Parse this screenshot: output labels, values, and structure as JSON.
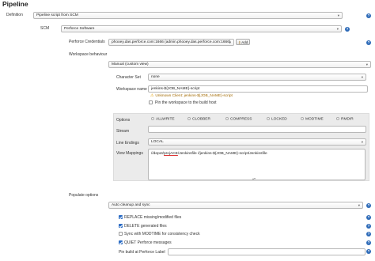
{
  "page": {
    "title": "Pipeline"
  },
  "definition": {
    "label": "Definition",
    "value": "Pipeline script from SCM"
  },
  "scm": {
    "label": "SCM",
    "value": "Perforce Software"
  },
  "credentials": {
    "label": "Perforce Credentials",
    "value": "phooey.das.perforce.com:1666 (admin.phooey.das.perforce.com:1666)",
    "add_label": "Add"
  },
  "workspace": {
    "section_label": "Workspace behaviour",
    "type_value": "Manual (custom view)",
    "charset_label": "Character Set",
    "charset_value": "none",
    "name_label": "Workspace name",
    "name_value": "jenkins-${JOB_NAME}-script",
    "warning": "Unknown Client: jenkins-${JOB_NAME}-script",
    "pin_label": "Pin the workspace to the build host"
  },
  "options": {
    "label": "Options",
    "items": [
      "ALLWRITE",
      "CLOBBER",
      "COMPRESS",
      "LOCKED",
      "MODTIME",
      "RMDIR"
    ],
    "stream_label": "Stream",
    "line_endings_label": "Line Endings",
    "line_endings_value": "LOCAL",
    "view_mappings_label": "View Mappings",
    "view_mappings_pre": "//depot/",
    "view_mappings_underlined": "projACE",
    "view_mappings_post": "/Jenkinsfile //jenkins-${JOB_NAME}-script/Jenkinsfile"
  },
  "populate": {
    "label": "Populate options",
    "value": "Auto cleanup and sync",
    "replace_label": "REPLACE missing/modified files",
    "delete_label": "DELETE generated files",
    "sync_modtime_label": "Sync with MODTIME for consistency check",
    "quiet_label": "QUIET Perforce messages",
    "pin_build_label": "Pin build at Perforce Label"
  },
  "icons": {
    "help": "?",
    "dropdown": "▾",
    "warning": "⚠",
    "key": "⚷",
    "resize": "▴▾"
  },
  "colors": {
    "help_badge": "#2e6bb8",
    "checkbox_checked": "#2c6cc4",
    "warning_text": "#a36a00",
    "options_panel_bg": "#ebebeb"
  }
}
